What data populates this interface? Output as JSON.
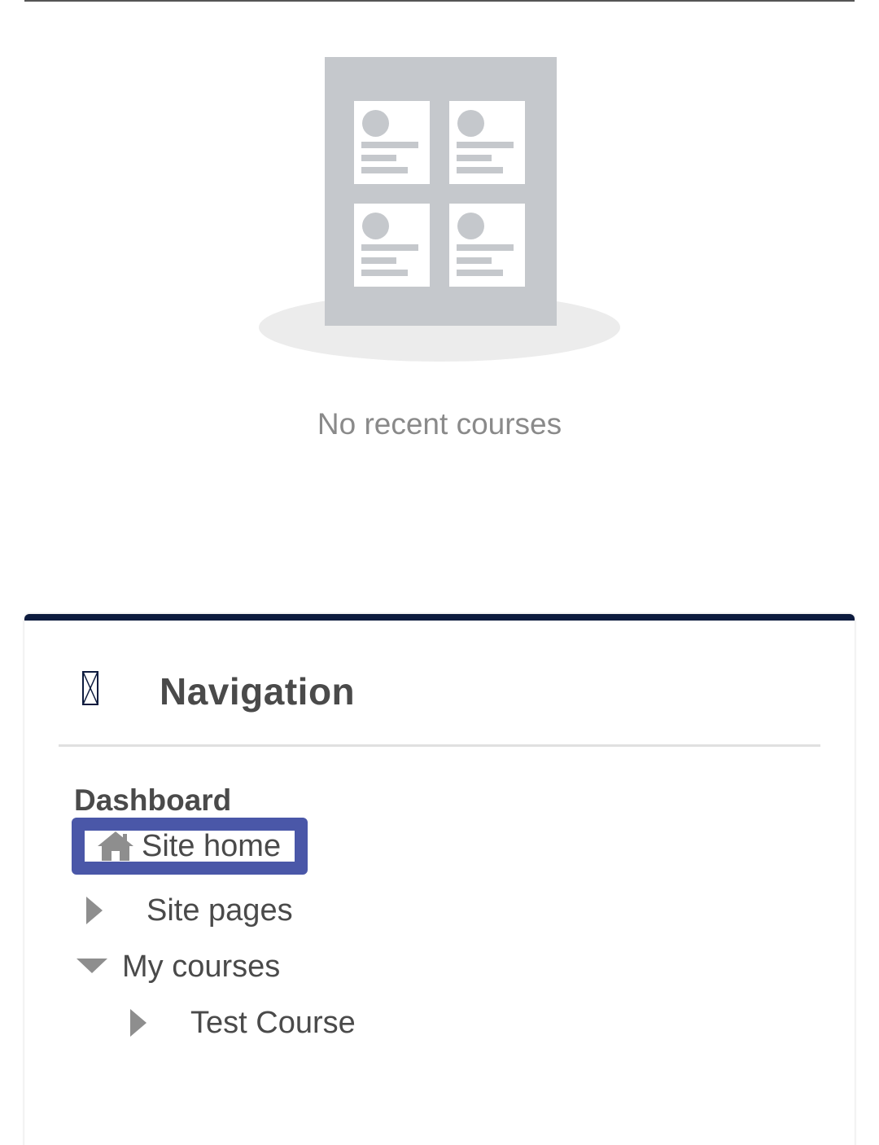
{
  "recent_courses": {
    "empty_message": "No recent courses"
  },
  "navigation": {
    "title": "Navigation",
    "header_icon": "missing-glyph-icon",
    "items": [
      {
        "label": "Dashboard",
        "icon": null,
        "bold": true
      },
      {
        "label": "Site home",
        "icon": "home-icon",
        "highlighted": true
      },
      {
        "label": "Site pages",
        "icon": "caret-right-icon"
      },
      {
        "label": "My courses",
        "icon": "caret-down-icon",
        "expanded": true
      },
      {
        "label": "Test Course",
        "icon": "caret-right-icon",
        "level": 2
      }
    ]
  },
  "colors": {
    "card_top_border": "#0d1b3e",
    "highlight_box": "#4a57a8",
    "text": "#4a4a4a",
    "muted_text": "#8a8a8a"
  }
}
